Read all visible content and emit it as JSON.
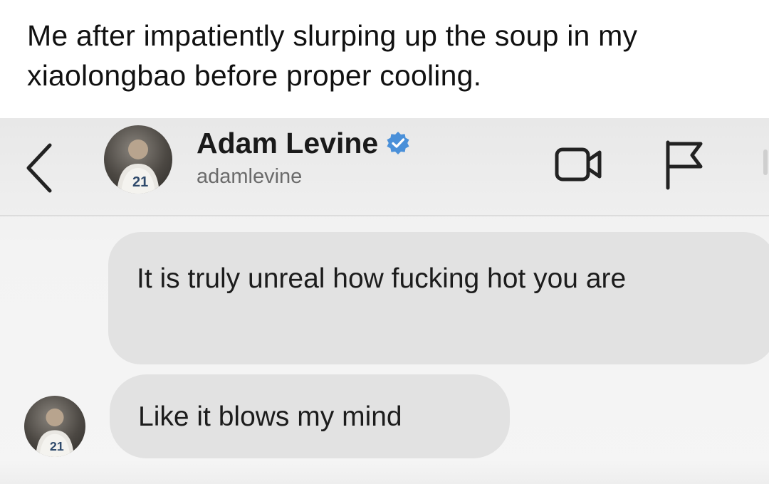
{
  "caption": {
    "text": "Me after impatiently slurping up the soup in my xiaolongbao before proper cooling."
  },
  "chat": {
    "header": {
      "name": "Adam Levine",
      "username": "adamlevine",
      "verified": true,
      "icons": {
        "back": "chevron-left-icon",
        "verified": "verified-badge-icon",
        "video": "video-camera-icon",
        "flag": "flag-icon"
      }
    },
    "avatar_jersey_number": "21",
    "messages": [
      {
        "text": "It is truly unreal how fucking hot you are"
      },
      {
        "text": "Like it blows my mind"
      }
    ]
  },
  "colors": {
    "bubble": "#e2e2e2",
    "verified_badge": "#4a90d9",
    "header_bg": "#ececec"
  }
}
